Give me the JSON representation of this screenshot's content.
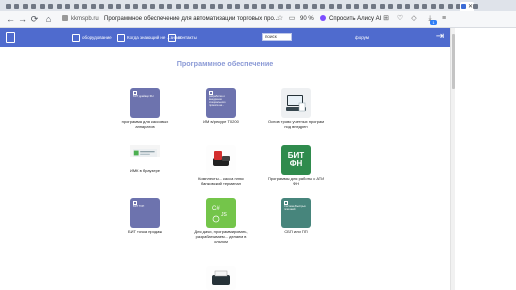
{
  "browser": {
    "tabs": [
      {
        "active": false
      },
      {
        "active": false
      },
      {
        "active": false
      },
      {
        "active": false
      },
      {
        "active": false
      },
      {
        "active": false
      },
      {
        "active": false
      },
      {
        "active": false
      },
      {
        "active": false
      },
      {
        "active": false
      },
      {
        "active": false
      },
      {
        "active": false
      },
      {
        "active": false
      },
      {
        "active": false
      },
      {
        "active": false
      },
      {
        "active": false
      },
      {
        "active": false
      },
      {
        "active": false
      },
      {
        "active": false
      },
      {
        "active": false
      },
      {
        "active": false
      },
      {
        "active": false
      },
      {
        "active": false
      },
      {
        "active": false
      },
      {
        "active": false
      },
      {
        "active": false
      },
      {
        "active": false
      },
      {
        "active": false
      },
      {
        "active": false
      },
      {
        "active": false
      },
      {
        "active": false
      },
      {
        "active": false
      },
      {
        "active": false
      },
      {
        "active": false
      },
      {
        "active": false
      },
      {
        "active": false
      },
      {
        "active": false
      },
      {
        "active": false
      },
      {
        "active": false
      },
      {
        "active": false
      },
      {
        "active": false
      },
      {
        "active": false
      },
      {
        "active": false
      },
      {
        "active": false
      },
      {
        "active": false
      },
      {
        "active": false
      },
      {
        "active": false
      },
      {
        "active": false
      },
      {
        "active": false
      },
      {
        "active": false
      },
      {
        "active": false
      },
      {
        "active": false
      },
      {
        "active": false
      },
      {
        "active": false
      },
      {
        "active": true
      },
      {
        "active": false
      }
    ],
    "tab_close": "✕",
    "url": "kkmspb.ru",
    "page_title": "Программное обеспечение для автоматизации торговых про...",
    "zoom": "90 %",
    "alice_label": "Спросить Алису AI",
    "downloads_badge": "1",
    "accent": "#3b6bd6"
  },
  "site": {
    "header_color": "#4f6bce",
    "nav": [
      {
        "label": "оборудование"
      },
      {
        "label": "Когда знающий не ...знает"
      },
      {
        "label": "контакты"
      }
    ],
    "search_placeholder": "поиск",
    "forum_label": "форум",
    "exit_icon": "exit-icon"
  },
  "main": {
    "heading": "Программное обеспечение",
    "tiles": [
      {
        "label": "программа для кассовых аппаратов",
        "caption": "БИТ драйвер ФН",
        "style": "purple"
      },
      {
        "label": "ИМ в/рекуре Т0200",
        "caption": "разработка и внедрение специального проекта на...",
        "style": "purple"
      },
      {
        "label": "Основ трово учетных програм под внедрен",
        "caption": "",
        "style": "photo"
      },
      {
        "label": "ИМК в браузере",
        "caption": "",
        "style": "banner"
      },
      {
        "label": "Комплекты... касса плюс банковский терминал",
        "caption": "",
        "style": "terminal"
      },
      {
        "label": "Программы для работы с АТИ ФН",
        "caption": "БИТ ФН",
        "style": "green"
      },
      {
        "label": "БИТ точка продаж",
        "caption": "БИТ ТОП",
        "style": "purple"
      },
      {
        "label": "Для дачи, программировать, разрабатываем... делаем в ольном",
        "caption": "",
        "style": "lime"
      },
      {
        "label": "СБП или ПП",
        "caption": "Система Быстрых платежей",
        "style": "teal"
      }
    ]
  }
}
